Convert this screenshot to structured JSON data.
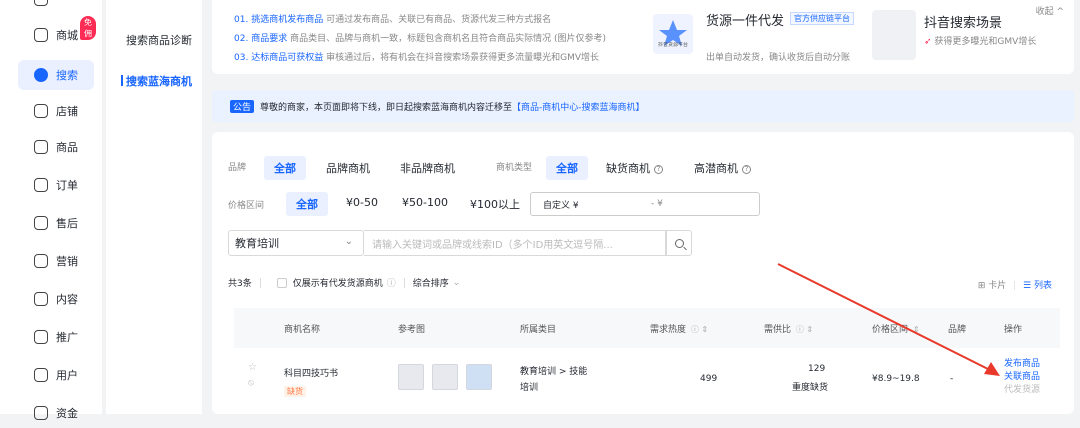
{
  "nav": {
    "items": [
      {
        "label": "商城",
        "badge": "免佣"
      },
      {
        "label": "搜索"
      },
      {
        "label": "店铺"
      },
      {
        "label": "商品"
      },
      {
        "label": "订单"
      },
      {
        "label": "售后"
      },
      {
        "label": "营销"
      },
      {
        "label": "内容"
      },
      {
        "label": "推广"
      },
      {
        "label": "用户"
      },
      {
        "label": "资金"
      }
    ]
  },
  "subnav": {
    "items": [
      "搜索商品诊断",
      "搜索蓝海商机"
    ]
  },
  "tips": {
    "collapse": "收起 ^",
    "lines": [
      {
        "num": "01.",
        "label": "挑选商机发布商品",
        "text": "可通过发布商品、关联已有商品、货源代发三种方式报名"
      },
      {
        "num": "02.",
        "label": "商品要求",
        "text": "商品类目、品牌与商机一致，标题包含商机名且符合商品实际情况 (图片仅参考)"
      },
      {
        "num": "03.",
        "label": "达标商品可获权益",
        "text": "审核通过后，将有机会在抖音搜索场景获得更多流量曝光和GMV增长"
      }
    ],
    "promo1": {
      "title": "货源一件代发",
      "tag": "官方供应链平台",
      "icon_caption": "抖音货源平台",
      "sub": "出单自动发货，确认收货后自动分账"
    },
    "promo2": {
      "title": "抖音搜索场景",
      "sub": "获得更多曝光和GMV增长"
    }
  },
  "notice": {
    "tag": "公告",
    "text": "尊敬的商家，本页面即将下线，即日起搜索蓝海商机内容迁移至",
    "link": "【商品-商机中心-搜索蓝海商机】"
  },
  "filters": {
    "brand_label": "品牌",
    "brand_options": [
      "全部",
      "品牌商机",
      "非品牌商机"
    ],
    "type_label": "商机类型",
    "type_options": [
      "全部",
      "缺货商机",
      "高潜商机"
    ],
    "price_label": "价格区间",
    "price_options": [
      "全部",
      "¥0-50",
      "¥50-100",
      "¥100以上"
    ],
    "custom_label": "自定义 ¥",
    "custom_sep": "- ¥",
    "category_value": "教育培训",
    "search_placeholder": "请输入关键词或品牌或线索ID（多个ID用英文逗号隔..."
  },
  "toolbar": {
    "count": "共3条",
    "only_dropship": "仅展示有代发货源商机",
    "sort": "综合排序",
    "view_card": "卡片",
    "view_list": "列表"
  },
  "table": {
    "headers": [
      "商机名称",
      "参考图",
      "所属类目",
      "需求热度",
      "需供比",
      "价格区间",
      "品牌",
      "操作"
    ],
    "rows": [
      {
        "name": "科目四技巧书",
        "tag": "缺货",
        "category_line1": "教育培训 > 技能",
        "category_line2": "培训",
        "heat": "499",
        "ratio": "129",
        "ratio_note": "重度缺货",
        "price": "¥8.9~19.8",
        "brand": "-",
        "ops": [
          "发布商品",
          "关联商品",
          "代发货源"
        ]
      }
    ]
  },
  "colors": {
    "accent": "#1966ff",
    "annotation_arrow": "#e8392b"
  }
}
